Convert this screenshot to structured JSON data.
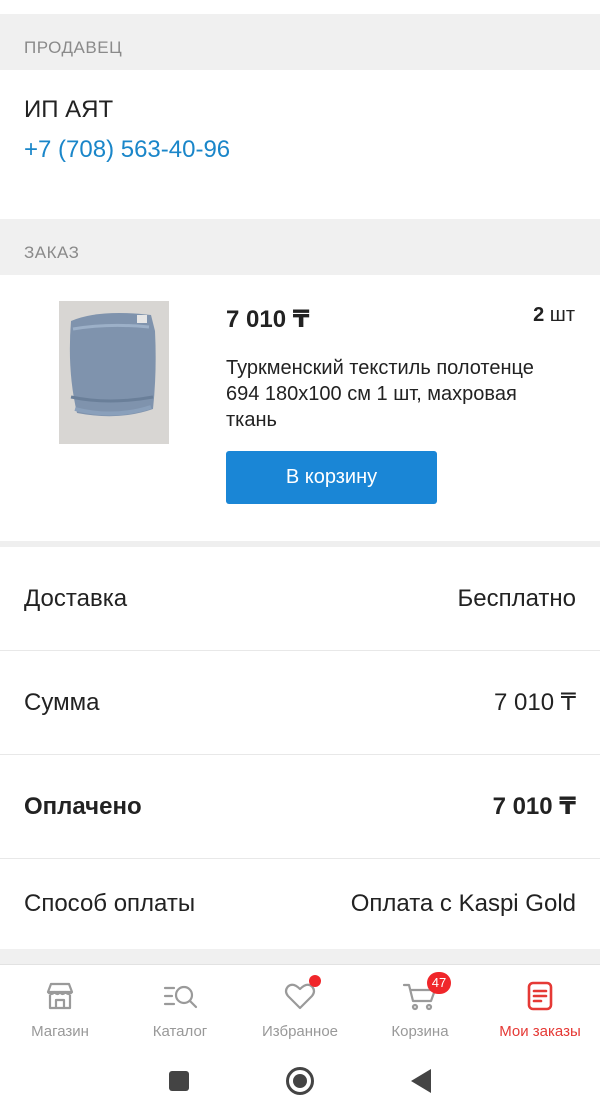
{
  "seller": {
    "header": "ПРОДАВЕЦ",
    "name": "ИП АЯТ",
    "phone": "+7 (708) 563-40-96"
  },
  "order": {
    "header": "ЗАКАЗ",
    "item": {
      "price": "7 010 ₸",
      "qty_number": "2",
      "qty_unit": "шт",
      "title": "Туркменский текстиль полотенце 694 180х100 см 1 шт, махровая ткань",
      "cart_button": "В корзину"
    }
  },
  "summary": [
    {
      "label": "Доставка",
      "value": "Бесплатно"
    },
    {
      "label": "Сумма",
      "value": "7 010 ₸"
    },
    {
      "label": "Оплачено",
      "value": "7 010 ₸"
    },
    {
      "label": "Способ оплаты",
      "value": "Оплата с Kaspi Gold"
    }
  ],
  "tabbar": {
    "items": [
      {
        "label": "Магазин",
        "icon": "shop-icon"
      },
      {
        "label": "Каталог",
        "icon": "catalog-search-icon"
      },
      {
        "label": "Избранное",
        "icon": "heart-icon"
      },
      {
        "label": "Корзина",
        "icon": "cart-icon",
        "badge": "47"
      },
      {
        "label": "Мои заказы",
        "icon": "orders-icon",
        "active": true
      }
    ]
  },
  "colors": {
    "accent_blue": "#1a86d6",
    "phone_blue": "#1a86c9",
    "active_red": "#e53935",
    "badge_red": "#f0262a"
  }
}
